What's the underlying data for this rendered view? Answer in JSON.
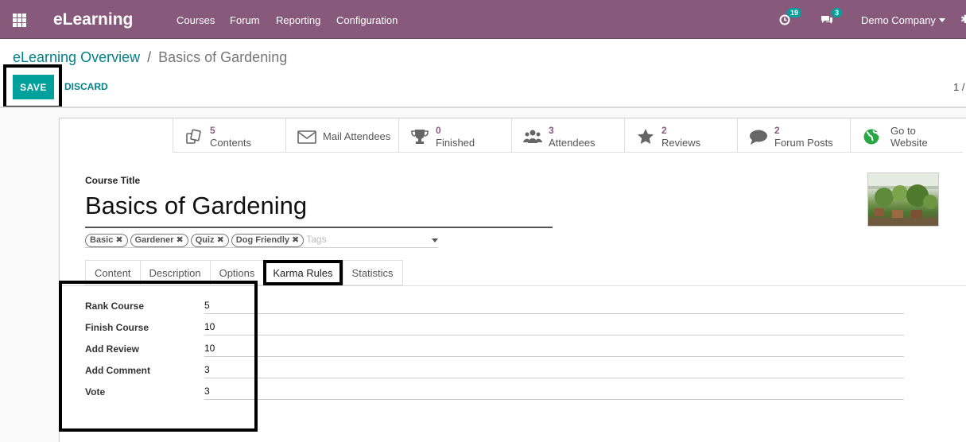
{
  "app": {
    "name": "eLearning"
  },
  "nav": {
    "items": [
      "Courses",
      "Forum",
      "Reporting",
      "Configuration"
    ]
  },
  "systray": {
    "activity_count": "19",
    "messages_count": "3",
    "company": "Demo Company"
  },
  "breadcrumb": {
    "parent": "eLearning Overview",
    "separator": "/",
    "current": "Basics of Gardening"
  },
  "controls": {
    "save": "SAVE",
    "discard": "DISCARD",
    "pager": "1 /"
  },
  "stats": [
    {
      "value": "5",
      "label": "Contents",
      "icon": "contents-icon"
    },
    {
      "label": "Mail Attendees",
      "icon": "mail-icon"
    },
    {
      "value": "0",
      "label": "Finished",
      "icon": "trophy-icon"
    },
    {
      "value": "3",
      "label": "Attendees",
      "icon": "users-icon"
    },
    {
      "value": "2",
      "label": "Reviews",
      "icon": "star-icon"
    },
    {
      "value": "2",
      "label": "Forum Posts",
      "icon": "comment-icon"
    },
    {
      "line1": "Go to",
      "line2": "Website",
      "icon": "globe-icon"
    }
  ],
  "form": {
    "course_title_label": "Course Title",
    "course_title": "Basics of Gardening",
    "tags": [
      "Basic",
      "Gardener",
      "Quiz",
      "Dog Friendly"
    ],
    "tags_placeholder": "Tags"
  },
  "tabs": [
    "Content",
    "Description",
    "Options",
    "Karma Rules",
    "Statistics"
  ],
  "active_tab": "Karma Rules",
  "karma_rules": [
    {
      "label": "Rank Course",
      "value": "5"
    },
    {
      "label": "Finish Course",
      "value": "10"
    },
    {
      "label": "Add Review",
      "value": "10"
    },
    {
      "label": "Add Comment",
      "value": "3"
    },
    {
      "label": "Vote",
      "value": "3"
    }
  ],
  "colors": {
    "brand": "#875a7b",
    "accent": "#00a09d",
    "link": "#00828a"
  }
}
